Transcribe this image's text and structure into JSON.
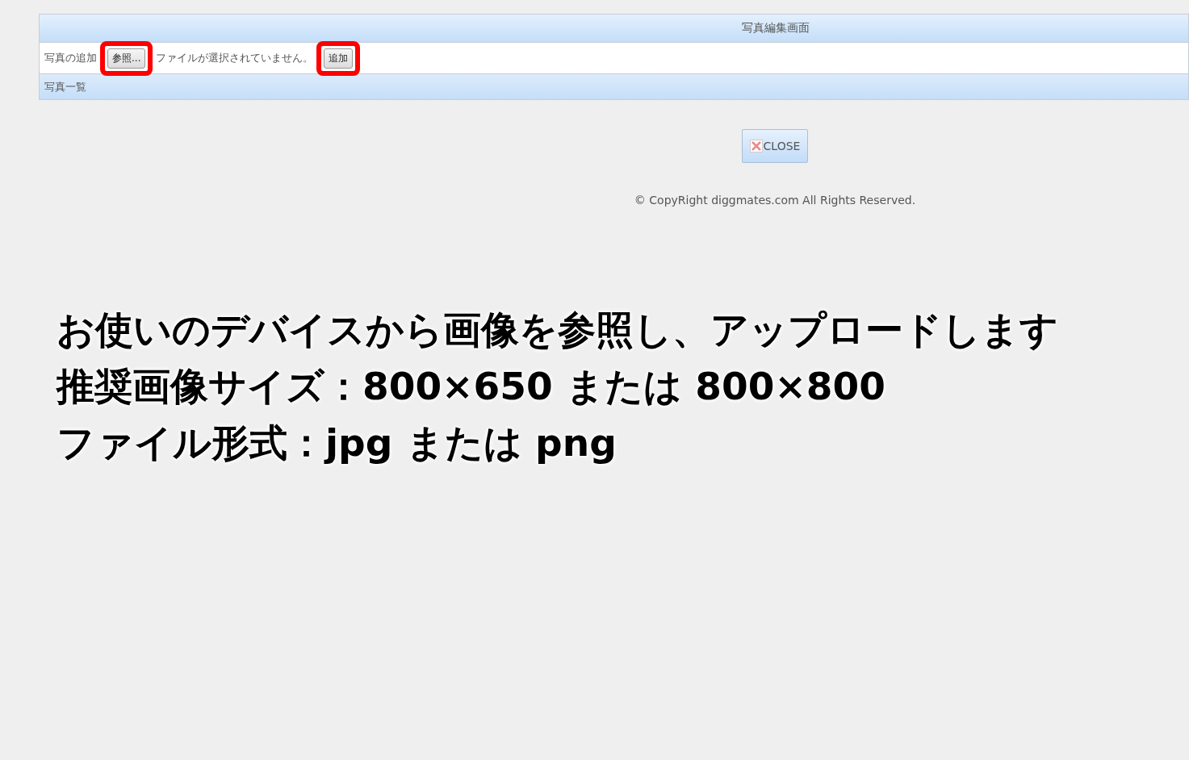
{
  "panel": {
    "title": "写真編集画面",
    "upload_label": "写真の追加",
    "browse_button": "参照...",
    "file_status": "ファイルが選択されていません。",
    "add_button": "追加",
    "list_heading": "写真一覧"
  },
  "close_button": "CLOSE",
  "footer": "© CopyRight diggmates.com All Rights Reserved.",
  "annotation": {
    "browse_highlighted": true,
    "add_highlighted": true,
    "caption": [
      "お使いのデバイスから画像を参照し、アップロードします",
      "推奨画像サイズ：800×650 または 800×800",
      "ファイル形式：jpg または png"
    ]
  }
}
